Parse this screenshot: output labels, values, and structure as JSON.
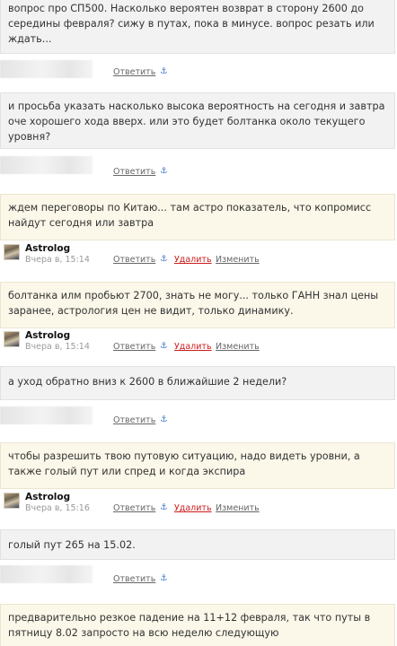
{
  "actions": {
    "reply": "Ответить",
    "delete": "Удалить",
    "edit": "Изменить",
    "anchor": "⚓"
  },
  "comments": [
    {
      "text": "вопрос про СП500. Насколько вероятен возврат в сторону 2600 до середины февраля? сижу в путах, пока в минусе. вопрос резать или ждать..."
    },
    {
      "text": "и просьба указать насколько высока вероятность на  сегодня и завтра оче хорошего хода вверх. или это будет болтанка около текущего уровня?"
    },
    {
      "text": "ждем переговоры по Китаю... там астро показатель, что копромисс найдут сегодня или завтра",
      "author": "Astrolog",
      "date": "Вчера в, 15:14"
    },
    {
      "text": "болтанка илм пробьют 2700, знать не могу... только ГАНН знал цены заранее, астрология цен не видит, только динамику.",
      "author": "Astrolog",
      "date": "Вчера в, 15:14"
    },
    {
      "text": "а уход обратно вниз к 2600 в ближайшие 2 недели?"
    },
    {
      "text": "чтобы разрешить твою путовую ситуацию, надо видеть уровни, а также голый пут или спред и когда экспира",
      "author": "Astrolog",
      "date": "Вчера в, 15:16"
    },
    {
      "text": " голый пут 265 на 15.02."
    },
    {
      "text": "предварительно резкое падение на 11+12 февраля, так что путы в пятницу 8.02 запросто на всю неделю следующую"
    }
  ]
}
